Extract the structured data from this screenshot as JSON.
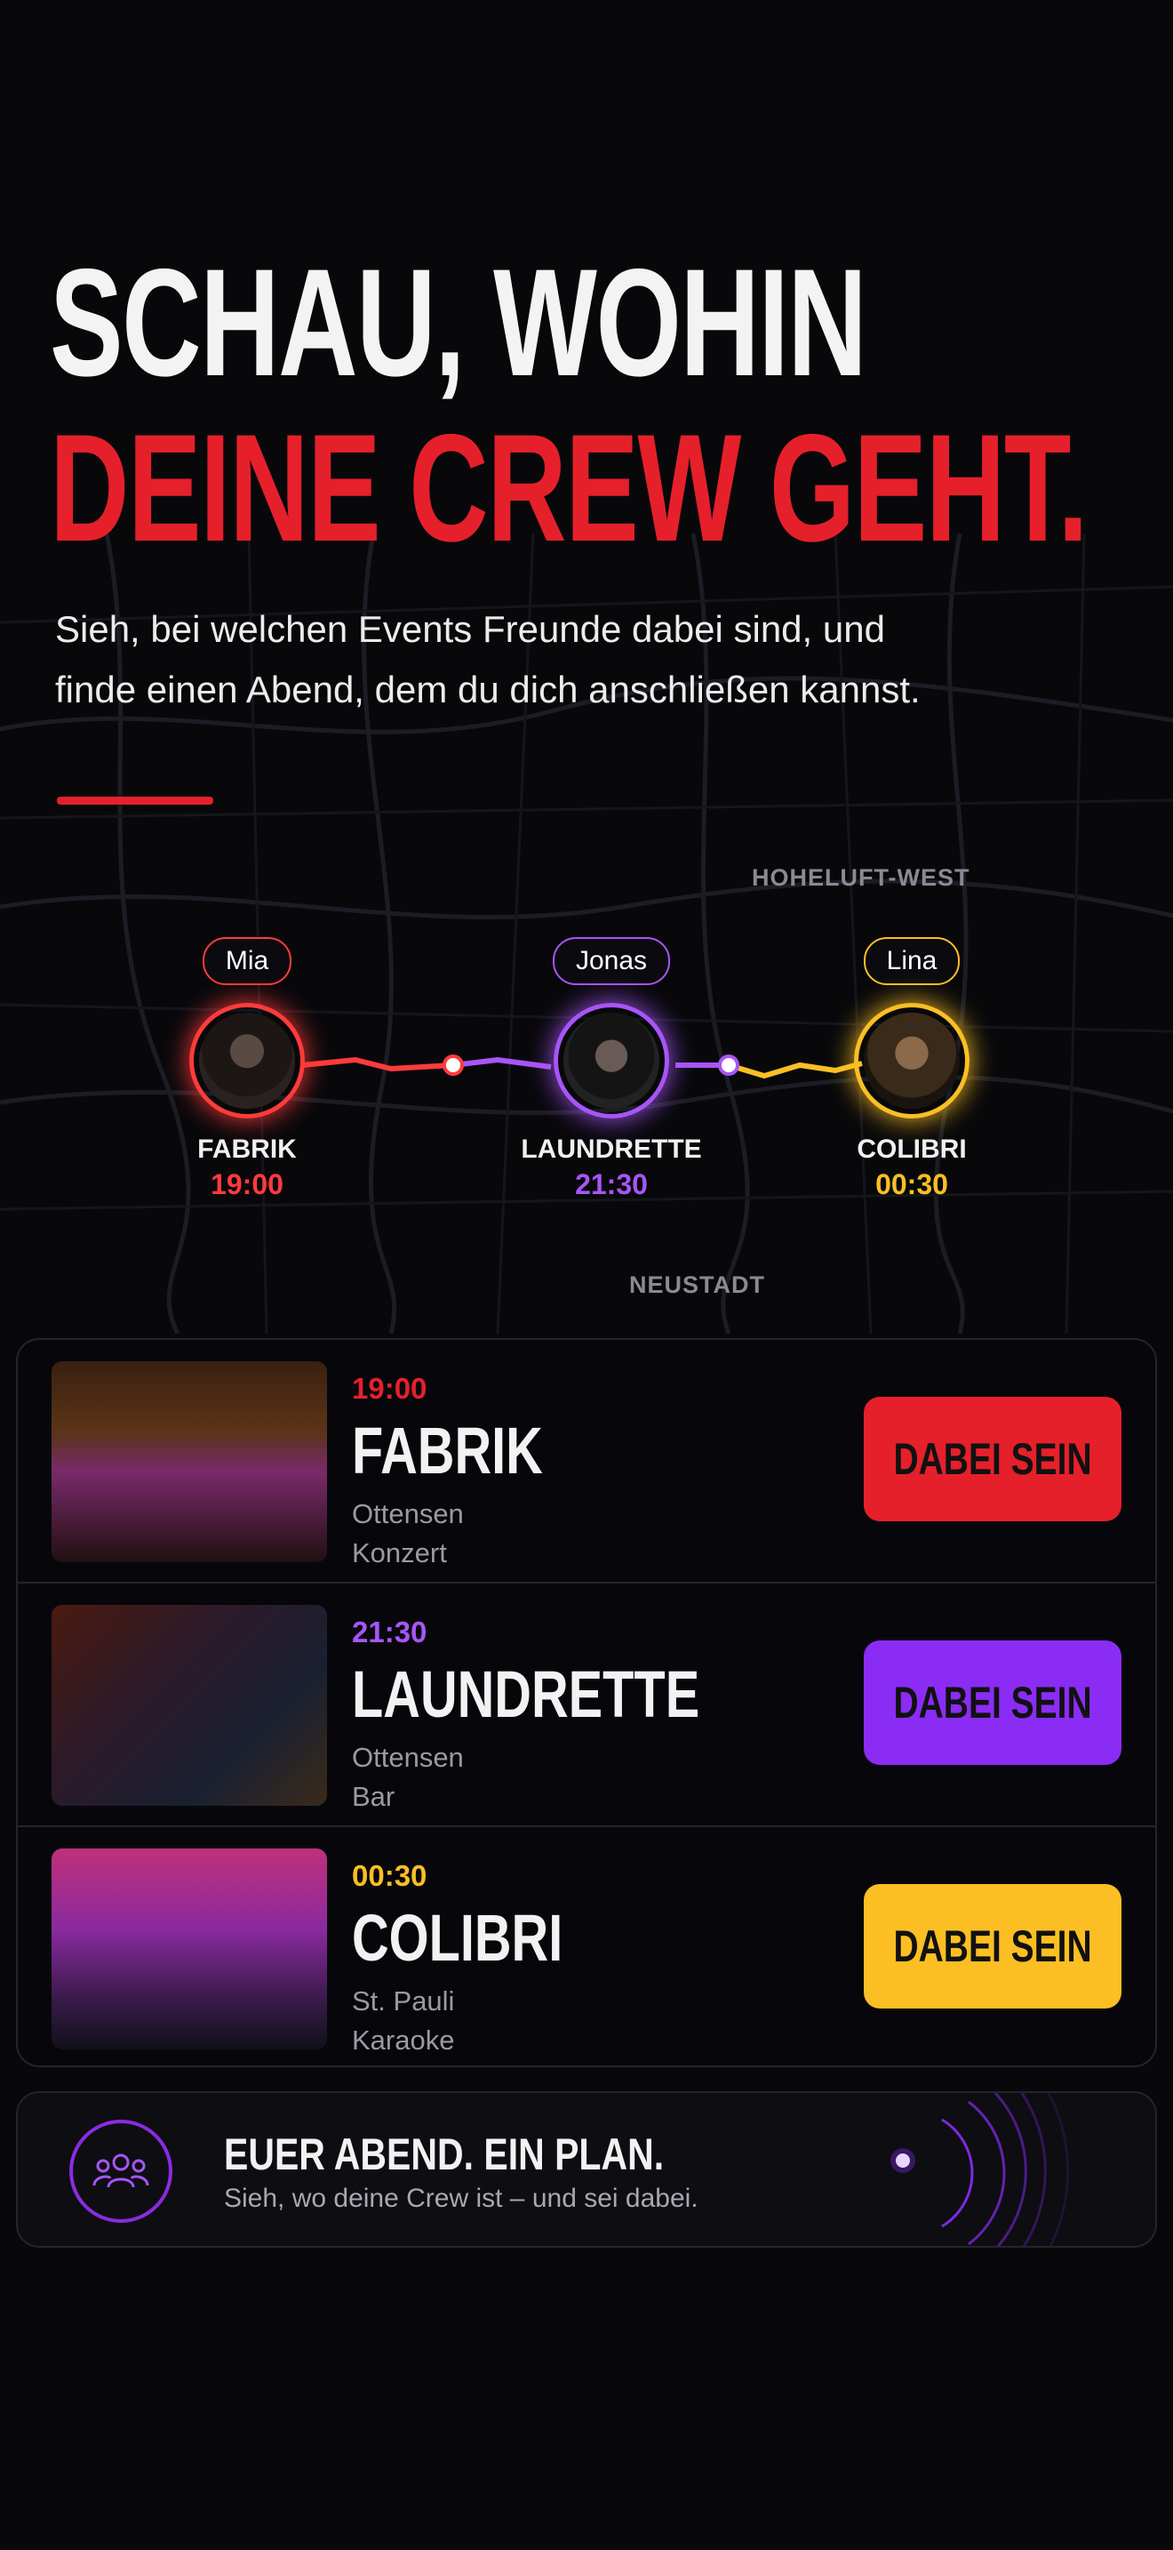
{
  "headline": {
    "line1": "SCHAU, WOHIN",
    "line2": "DEINE CREW GEHT."
  },
  "subtitle": "Sieh, bei welchen Events Freunde dabei sind, und finde einen Abend, dem du dich anschließen kannst.",
  "map": {
    "district_top": "HOHELUFT-WEST",
    "district_bottom": "NEUSTADT"
  },
  "friends": [
    {
      "name": "Mia",
      "venue": "FABRIK",
      "time": "19:00",
      "color": "#ff3b3b"
    },
    {
      "name": "Jonas",
      "venue": "LAUNDRETTE",
      "time": "21:30",
      "color": "#a855f7"
    },
    {
      "name": "Lina",
      "venue": "COLIBRI",
      "time": "00:30",
      "color": "#fbbf24"
    }
  ],
  "events": [
    {
      "time": "19:00",
      "name": "FABRIK",
      "district": "Ottensen",
      "type": "Konzert",
      "button": "DABEI SEIN",
      "color": "#e5202b"
    },
    {
      "time": "21:30",
      "name": "LAUNDRETTE",
      "district": "Ottensen",
      "type": "Bar",
      "button": "DABEI SEIN",
      "color": "#8b2cf5"
    },
    {
      "time": "00:30",
      "name": "COLIBRI",
      "district": "St. Pauli",
      "type": "Karaoke",
      "button": "DABEI SEIN",
      "color": "#fbbf24"
    }
  ],
  "footer": {
    "icon": "group-icon",
    "title": "EUER ABEND. EIN PLAN.",
    "subtitle": "Sieh, wo deine Crew ist – und sei dabei."
  }
}
